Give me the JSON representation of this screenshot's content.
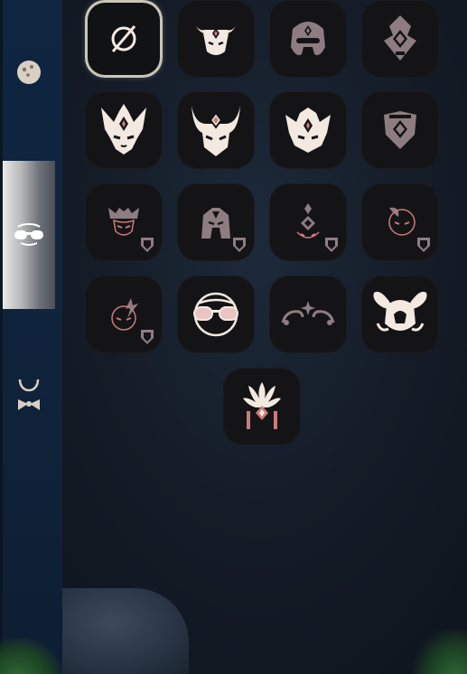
{
  "colors": {
    "icon_light": "#f3e9e1",
    "icon_dim": "#8e7d80",
    "tile_bg": "#141417",
    "accent_rose": "#c97b7b",
    "selected_border": "#c9c6b8"
  },
  "sidebar": {
    "tabs": [
      {
        "icon": "face-round-icon",
        "active": false
      },
      {
        "icon": "sunglasses-icon",
        "active": true
      },
      {
        "icon": "bowtie-necklace-icon",
        "active": false
      }
    ]
  },
  "grid": {
    "items": [
      {
        "icon": "none-icon",
        "state": "selected",
        "locked": false
      },
      {
        "icon": "bull-horn-mask-icon",
        "state": "owned",
        "locked": false
      },
      {
        "icon": "guardian-mask-icon",
        "state": "dim",
        "locked": false
      },
      {
        "icon": "diamond-totem-icon",
        "state": "dim",
        "locked": false
      },
      {
        "icon": "horned-crown-mask-icon",
        "state": "owned",
        "locked": false
      },
      {
        "icon": "curved-horn-mask-icon",
        "state": "owned",
        "locked": false
      },
      {
        "icon": "spiky-crown-mask-icon",
        "state": "owned",
        "locked": false
      },
      {
        "icon": "shield-emblem-icon",
        "state": "dim",
        "locked": false
      },
      {
        "icon": "crown-face-icon",
        "state": "locked",
        "locked": true
      },
      {
        "icon": "helmet-face-icon",
        "state": "locked",
        "locked": true
      },
      {
        "icon": "diamond-face-icon",
        "state": "locked",
        "locked": true
      },
      {
        "icon": "curl-face-icon",
        "state": "locked",
        "locked": true
      },
      {
        "icon": "flame-face-icon",
        "state": "locked",
        "locked": true
      },
      {
        "icon": "round-sunglasses-icon",
        "state": "owned",
        "locked": false
      },
      {
        "icon": "star-brow-icon",
        "state": "dim",
        "locked": false
      },
      {
        "icon": "winged-spirit-icon",
        "state": "owned",
        "locked": false
      },
      {
        "icon": "feather-headdress-icon",
        "state": "owned",
        "locked": false
      }
    ]
  }
}
